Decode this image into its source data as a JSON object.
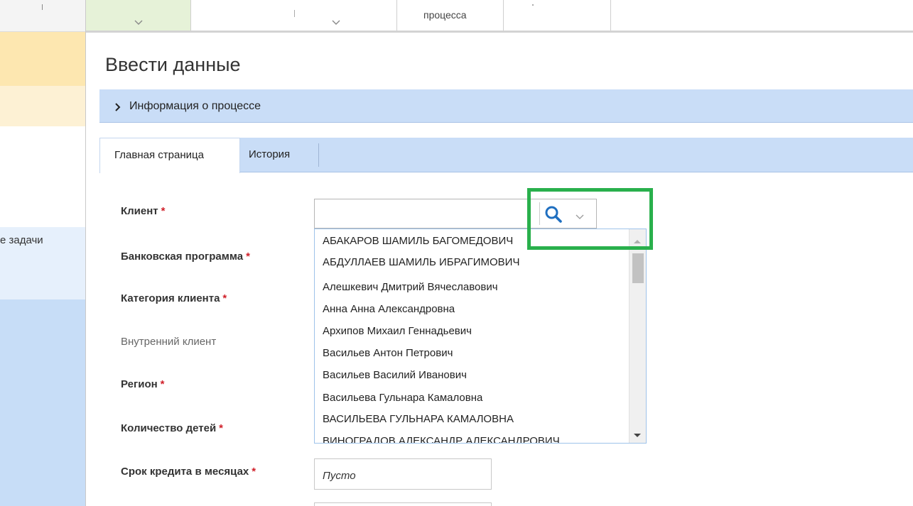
{
  "sidebar": {
    "task_label": "е задачи"
  },
  "topbar": {
    "process_label": "процесса"
  },
  "page": {
    "title": "Ввести данные"
  },
  "info_section": {
    "label": "Информация о процессе"
  },
  "tabs": [
    {
      "label": "Главная страница",
      "active": true
    },
    {
      "label": "История",
      "active": false
    }
  ],
  "form": {
    "required_marker": "*",
    "fields": {
      "client": {
        "label": "Клиент",
        "value": ""
      },
      "bank_program": {
        "label": "Банковская программа"
      },
      "client_category": {
        "label": "Категория клиента"
      },
      "internal_client": {
        "label": "Внутренний клиент"
      },
      "region": {
        "label": "Регион"
      },
      "children_count": {
        "label": "Количество детей"
      },
      "loan_term": {
        "label": "Срок кредита в месяцах",
        "placeholder": "Пусто"
      }
    }
  },
  "dropdown": {
    "items": [
      "АБАКАРОВ ШАМИЛЬ БАГОМЕДОВИЧ",
      "АБДУЛЛАЕВ ШАМИЛЬ ИБРАГИМОВИЧ",
      "Алешкевич Дмитрий Вячеславович",
      "Анна Анна Александровна",
      "Архипов Михаил Геннадьевич",
      "Васильев Антон Петрович",
      "Васильев Василий Иванович",
      "Васильева Гульнара Камаловна",
      "ВАСИЛЬЕВА ГУЛЬНАРА КАМАЛОВНА",
      "ВИНОГРАДОВ АЛЕКСАНДР АЛЕКСАНДРОВИЧ"
    ]
  },
  "colors": {
    "highlight": "#29b04c",
    "accent_bar": "#c9ddf7",
    "required": "#d0202a",
    "search_icon": "#1f6fc0"
  },
  "icons": {
    "search": "search-icon",
    "dropdown": "chevron-down-icon",
    "expand": "chevron-right-icon"
  }
}
